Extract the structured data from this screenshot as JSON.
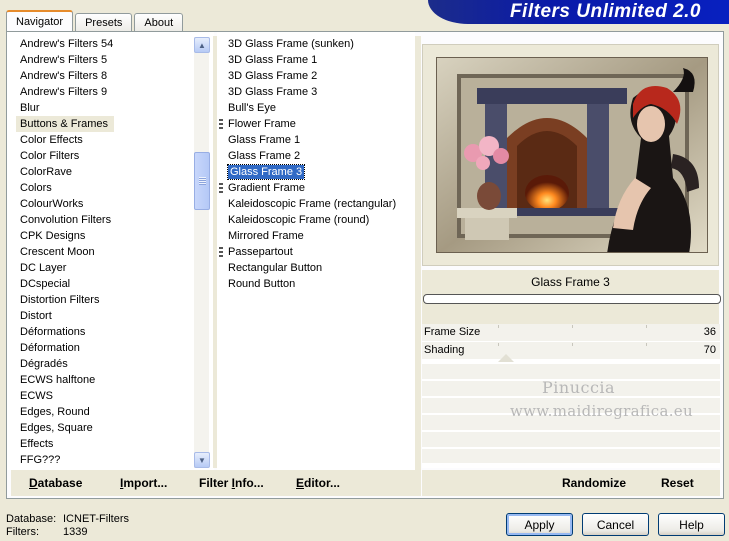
{
  "tabs": [
    "Navigator",
    "Presets",
    "About"
  ],
  "banner_title": "Filters Unlimited 2.0",
  "categories": [
    "Andrew's Filters 54",
    "Andrew's Filters 5",
    "Andrew's Filters 8",
    "Andrew's Filters 9",
    "Blur",
    "Buttons & Frames",
    "Color Effects",
    "Color Filters",
    "ColorRave",
    "Colors",
    "ColourWorks",
    "Convolution Filters",
    "CPK Designs",
    "Crescent Moon",
    "DC Layer",
    "DCspecial",
    "Distortion Filters",
    "Distort",
    "Déformations",
    "Déformation",
    "Dégradés",
    "ECWS halftone",
    "ECWS",
    "Edges, Round",
    "Edges, Square",
    "Effects",
    "FFG???"
  ],
  "selected_category": "Buttons & Frames",
  "filters": [
    {
      "label": "3D Glass Frame (sunken)",
      "grip": false
    },
    {
      "label": "3D Glass Frame 1",
      "grip": false
    },
    {
      "label": "3D Glass Frame 2",
      "grip": false
    },
    {
      "label": "3D Glass Frame 3",
      "grip": false
    },
    {
      "label": "Bull's Eye",
      "grip": false
    },
    {
      "label": "Flower Frame",
      "grip": true
    },
    {
      "label": "Glass Frame 1",
      "grip": false
    },
    {
      "label": "Glass Frame 2",
      "grip": false
    },
    {
      "label": "Glass Frame 3",
      "grip": false
    },
    {
      "label": "Gradient Frame",
      "grip": true
    },
    {
      "label": "Kaleidoscopic Frame (rectangular)",
      "grip": false
    },
    {
      "label": "Kaleidoscopic Frame (round)",
      "grip": false
    },
    {
      "label": "Mirrored Frame",
      "grip": false
    },
    {
      "label": "Passepartout",
      "grip": true
    },
    {
      "label": "Rectangular Button",
      "grip": false
    },
    {
      "label": "Round Button",
      "grip": false
    }
  ],
  "selected_filter": "Glass Frame 3",
  "left_buttons": {
    "database": "Database",
    "import": "Import...",
    "filter_info": "Filter Info...",
    "editor": "Editor..."
  },
  "current_filter_name": "Glass Frame 3",
  "params": [
    {
      "label": "Frame Size",
      "value": "36"
    },
    {
      "label": "Shading",
      "value": "70"
    }
  ],
  "watermark": {
    "line1": "Pinuccia",
    "line2": "www.maidiregrafica.eu"
  },
  "right_buttons": {
    "randomize": "Randomize",
    "reset": "Reset"
  },
  "status": {
    "database_label": "Database:",
    "database_value": "ICNET-Filters",
    "filters_label": "Filters:",
    "filters_value": "1339"
  },
  "dialog_buttons": {
    "apply": "Apply",
    "cancel": "Cancel",
    "help": "Help"
  },
  "icons": {
    "scroll_up": "up-arrow-icon",
    "scroll_down": "down-arrow-icon"
  }
}
